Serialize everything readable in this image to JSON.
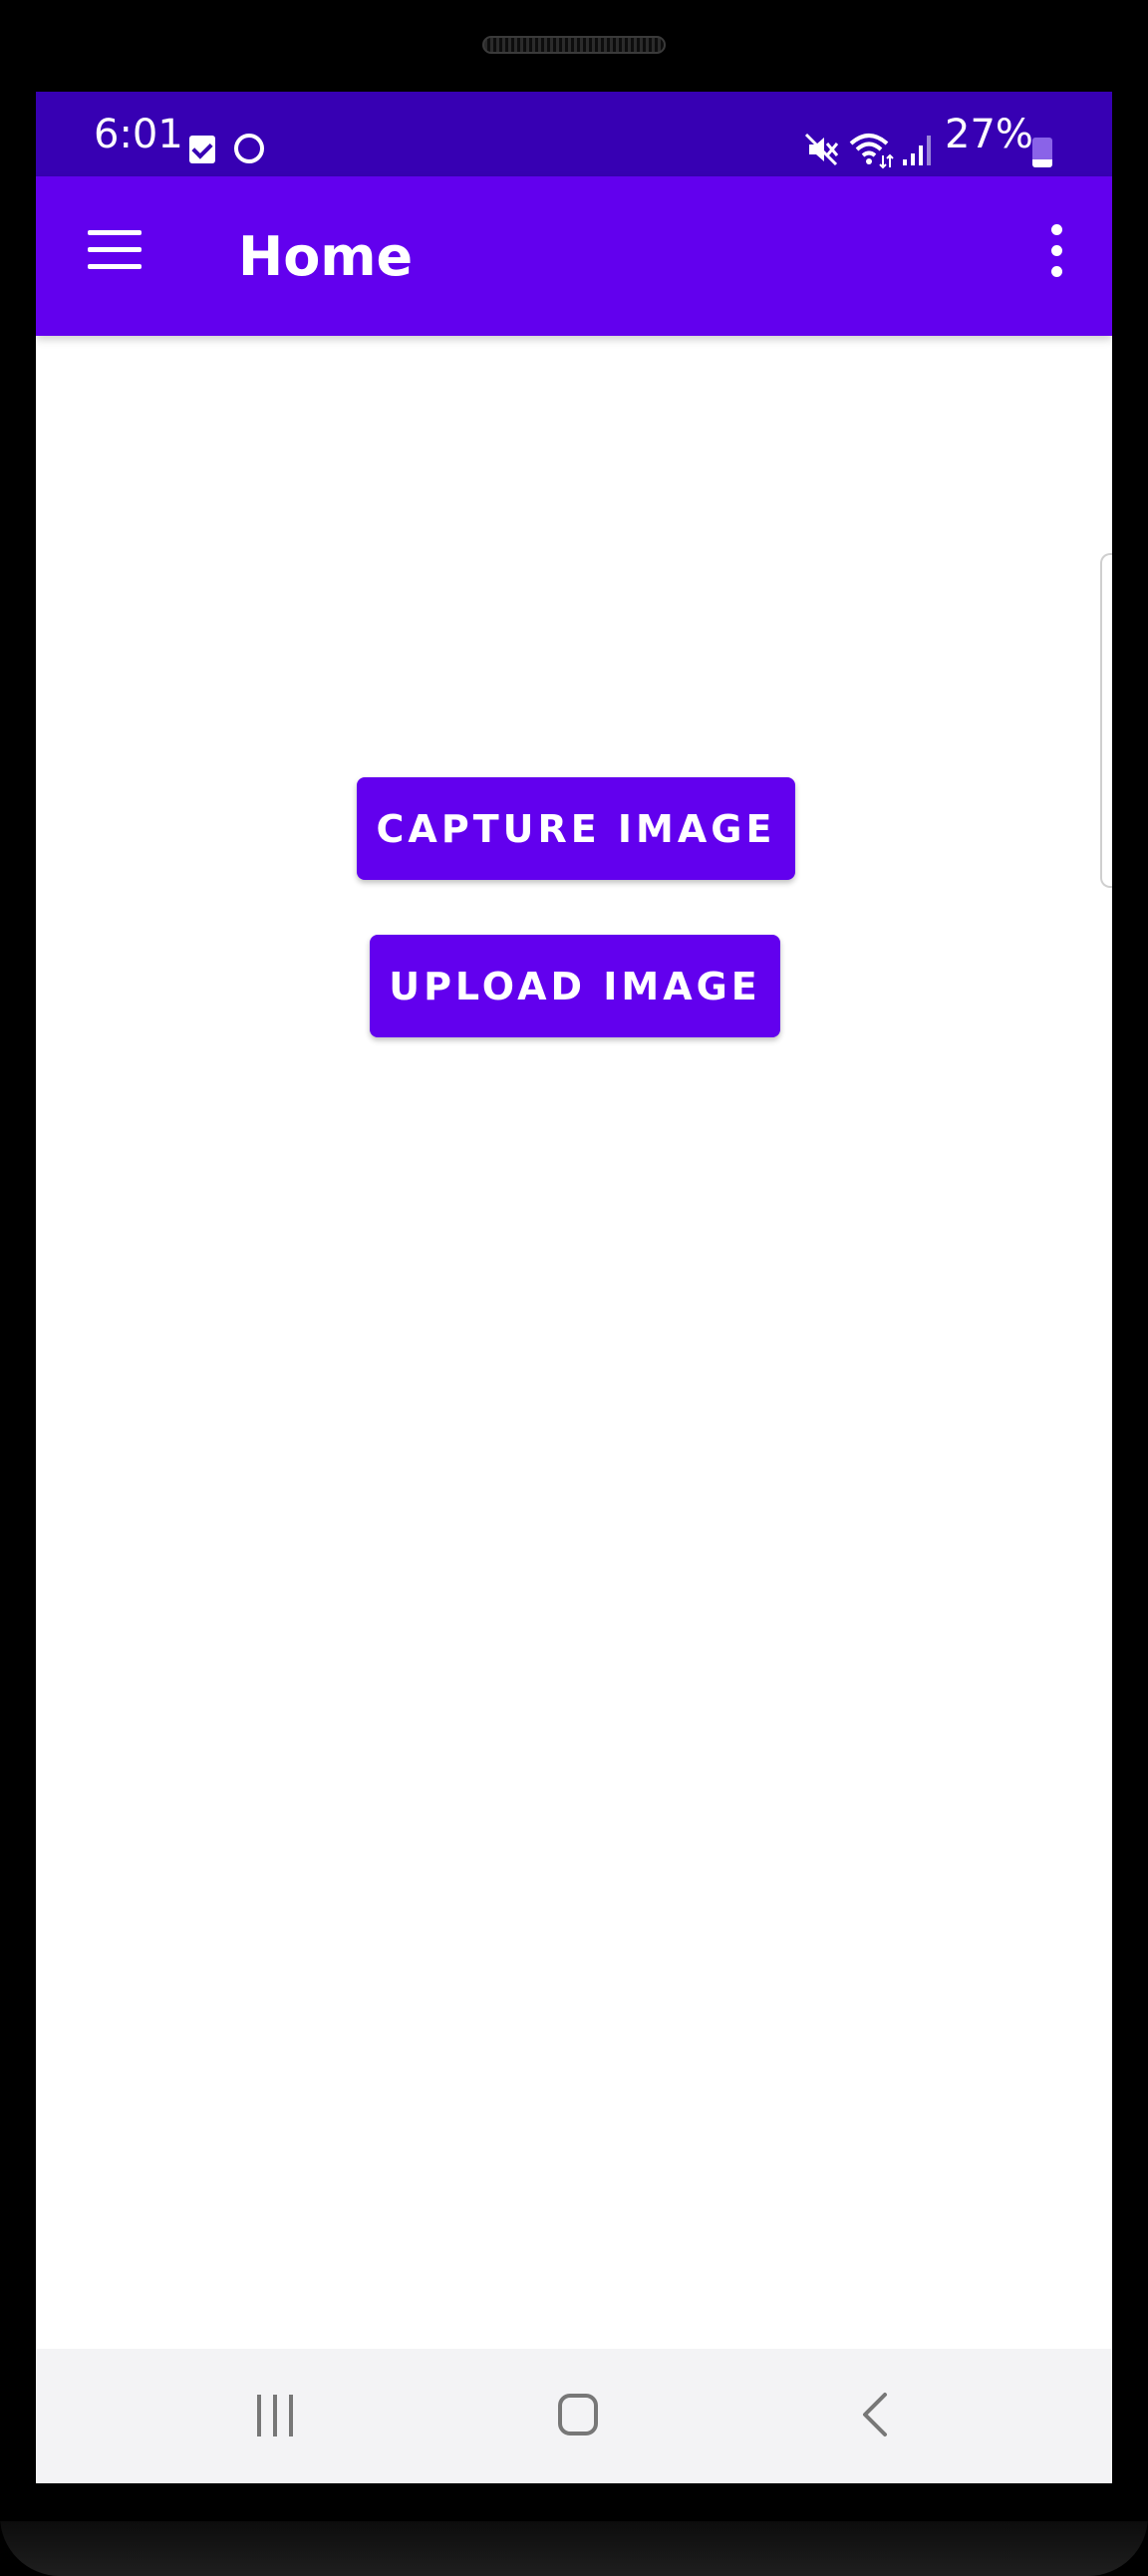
{
  "status_bar": {
    "time": "6:01",
    "battery_percent": "27%",
    "battery_level": 0.27,
    "icons": [
      "checkbox-notification-icon",
      "cat-notification-icon",
      "mute-icon",
      "wifi-icon",
      "signal-icon",
      "battery-icon"
    ]
  },
  "app_bar": {
    "title": "Home",
    "icons": [
      "menu-icon",
      "overflow-menu-icon"
    ]
  },
  "main": {
    "capture_label": "CAPTURE IMAGE",
    "upload_label": "UPLOAD IMAGE"
  },
  "nav_bar": {
    "icons": [
      "recents-icon",
      "home-icon",
      "back-icon"
    ]
  },
  "colors": {
    "status_bar": "#3700b3",
    "app_bar": "#6200ee",
    "button": "#6200ee",
    "background": "#ffffff",
    "nav_bar": "#f3f3f5"
  }
}
